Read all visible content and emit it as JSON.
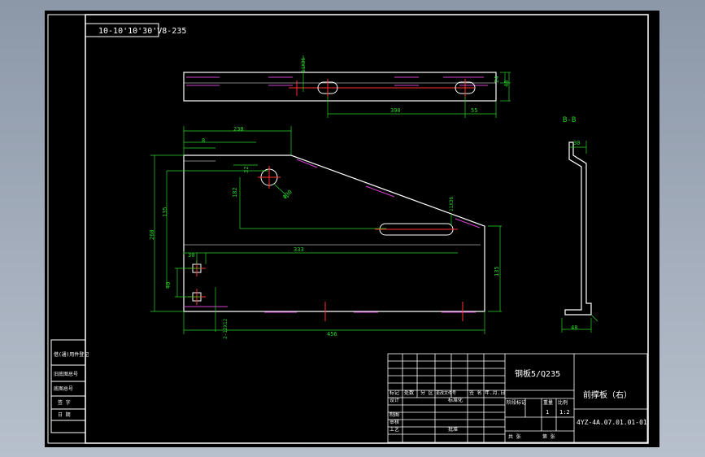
{
  "drawing": {
    "top_left_code": "10-10'10'30'V8-235",
    "section_label": "B-B",
    "material": "钢板5/Q235",
    "part_name": "前撑板（右）",
    "drawing_number": "4YZ-4A.07.01.01-01",
    "scale": "1:2",
    "unit_count": "1"
  },
  "title_block": {
    "hdr_mark": "标记",
    "hdr_count": "处数",
    "hdr_zone": "分 区",
    "hdr_doc": "更改文件号",
    "hdr_sign": "签 名",
    "hdr_date": "年.月.日",
    "design": "设计",
    "standard": "标准化",
    "check": "审核",
    "drawn": "制图",
    "process": "工艺",
    "approve": "批准",
    "stage_mark": "阶段标记",
    "weight": "重量",
    "ratio": "比例",
    "sheets_total": "共  张",
    "sheet_no": "第  张"
  },
  "side_table": [
    "借(通)用件登记",
    "旧底图总号",
    "底图总号",
    "签 字",
    "日 期"
  ],
  "dimensions": {
    "top_slot": "11X36",
    "top_width": "24",
    "top_total": "48",
    "top_span": "390",
    "top_edge": "55",
    "top_length": "238",
    "offset_8": "8",
    "height_32": "32",
    "hole_dia": "Φ30",
    "height_182": "182",
    "height_135": "135",
    "overall_height": "260",
    "length_333": "333",
    "slot_label": "11X36",
    "right_height": "135",
    "width_30": "30",
    "hole_spacing": "40",
    "bottom_left": "2-12X12",
    "bottom_length": "456",
    "section_top": "30",
    "section_bottom": "48"
  },
  "colors": {
    "line": "#ffffff",
    "dimension": "#28d428",
    "center": "#ff3030",
    "hidden": "#d040d0",
    "background": "#000000"
  }
}
